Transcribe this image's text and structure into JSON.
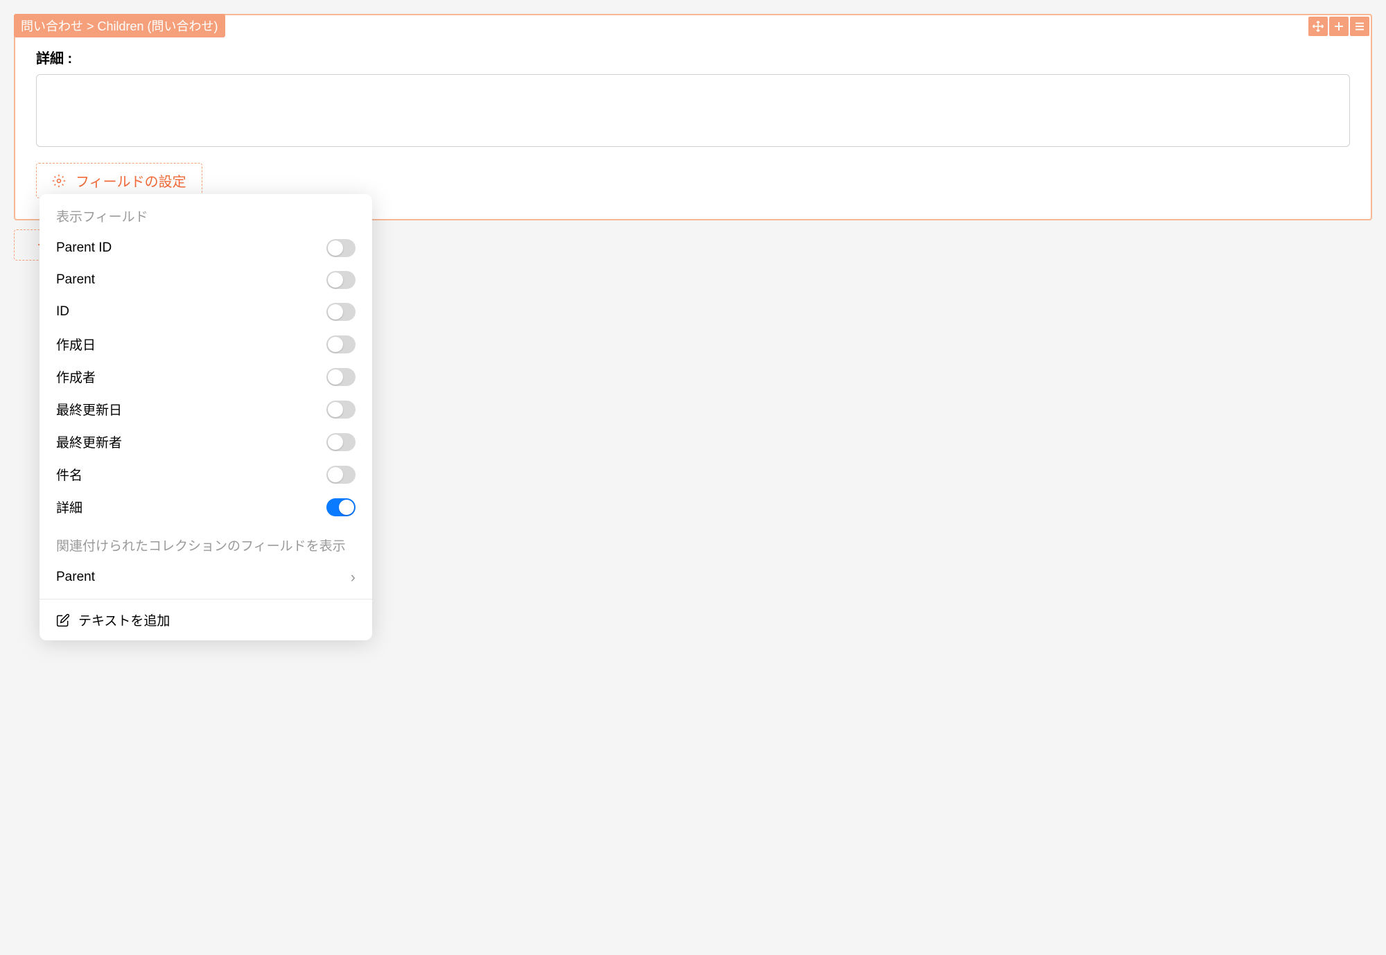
{
  "breadcrumb": "問い合わせ > Children (問い合わせ)",
  "section": {
    "detail_label": "詳細 :"
  },
  "buttons": {
    "field_settings": "フィールドの設定"
  },
  "popup": {
    "section_title": "表示フィールド",
    "related_section_title": "関連付けられたコレクションのフィールドを表示",
    "add_text_label": "テキストを追加",
    "fields": [
      {
        "label": "Parent ID",
        "enabled": false
      },
      {
        "label": "Parent",
        "enabled": false
      },
      {
        "label": "ID",
        "enabled": false
      },
      {
        "label": "作成日",
        "enabled": false
      },
      {
        "label": "作成者",
        "enabled": false
      },
      {
        "label": "最終更新日",
        "enabled": false
      },
      {
        "label": "最終更新者",
        "enabled": false
      },
      {
        "label": "件名",
        "enabled": false
      },
      {
        "label": "詳細",
        "enabled": true
      }
    ],
    "related_items": [
      {
        "label": "Parent"
      }
    ]
  }
}
